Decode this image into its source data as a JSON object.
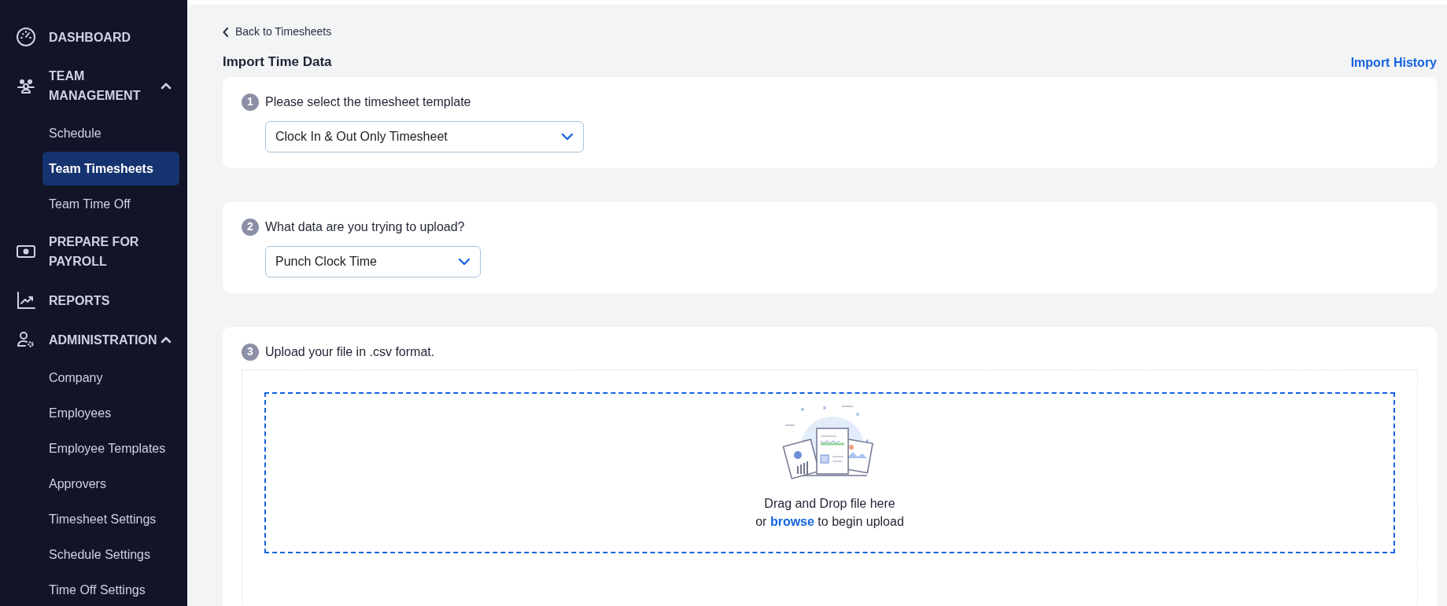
{
  "sidebar": {
    "items": [
      {
        "label": "DASHBOARD"
      },
      {
        "label": "TEAM MANAGEMENT",
        "expanded": true,
        "children": [
          {
            "label": "Schedule",
            "selected": false
          },
          {
            "label": "Team Timesheets",
            "selected": true
          },
          {
            "label": "Team Time Off",
            "selected": false
          }
        ]
      },
      {
        "label": "PREPARE FOR PAYROLL"
      },
      {
        "label": "REPORTS"
      },
      {
        "label": "ADMINISTRATION",
        "expanded": true,
        "children": [
          {
            "label": "Company",
            "selected": false
          },
          {
            "label": "Employees",
            "selected": false
          },
          {
            "label": "Employee Templates",
            "selected": false
          },
          {
            "label": "Approvers",
            "selected": false
          },
          {
            "label": "Timesheet Settings",
            "selected": false
          },
          {
            "label": "Schedule Settings",
            "selected": false
          },
          {
            "label": "Time Off Settings",
            "selected": false
          }
        ]
      }
    ]
  },
  "back_link": "Back to Timesheets",
  "page_title": "Import Time Data",
  "import_history_link": "Import History",
  "steps": [
    {
      "number": "1",
      "label": "Please select the timesheet template",
      "kind": "select",
      "value": "Clock In & Out Only Timesheet"
    },
    {
      "number": "2",
      "label": "What data are you trying to upload?",
      "kind": "select",
      "value": "Punch Clock Time"
    },
    {
      "number": "3",
      "label": "Upload your file in .csv format.",
      "kind": "upload",
      "drop_text": "Drag and Drop file here",
      "browse_prefix": "or",
      "browse_link": "browse",
      "browse_suffix": "to begin upload"
    }
  ]
}
